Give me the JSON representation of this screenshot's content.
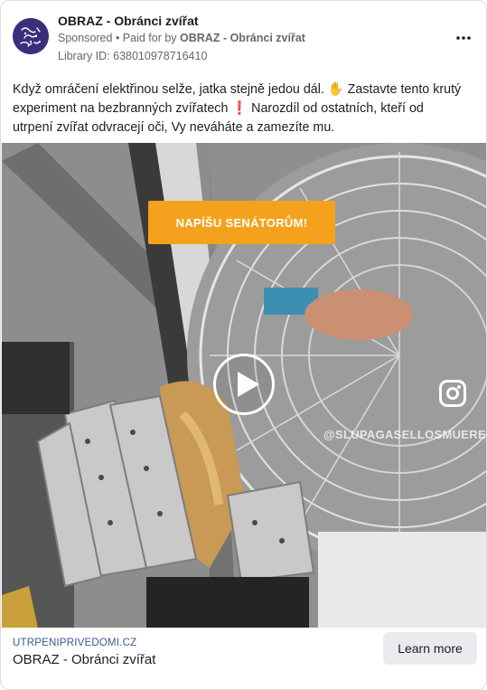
{
  "header": {
    "page_name": "OBRAZ - Obránci zvířat",
    "sponsored": "Sponsored",
    "paid_for_by_prefix": " • Paid for by ",
    "paid_for_by": "OBRAZ - Obránci zvířat",
    "library_id": "Library ID: 638010978716410",
    "more_icon": "more-horizontal-icon"
  },
  "body": {
    "text": "Když omráčení elektřinou selže, jatka stejně jedou dál. ✋ Zastavte tento krutý experiment na bezbranných zvířatech ❗ Narozdíl od ostatních, kteří od utrpení zvířat odvracejí oči, Vy neváháte a zamezíte mu."
  },
  "media": {
    "banner_text": "NAPÍŠU SENÁTORŮM!",
    "watermark": "@SLUPAGASELLOSMUEREN",
    "play_icon": "play-icon",
    "instagram_icon": "instagram-icon",
    "banner_color": "#f4a21d"
  },
  "footer": {
    "domain": "UTRPENIPRIVEDOMI.CZ",
    "title": "OBRAZ - Obránci zvířat",
    "cta_label": "Learn more"
  }
}
